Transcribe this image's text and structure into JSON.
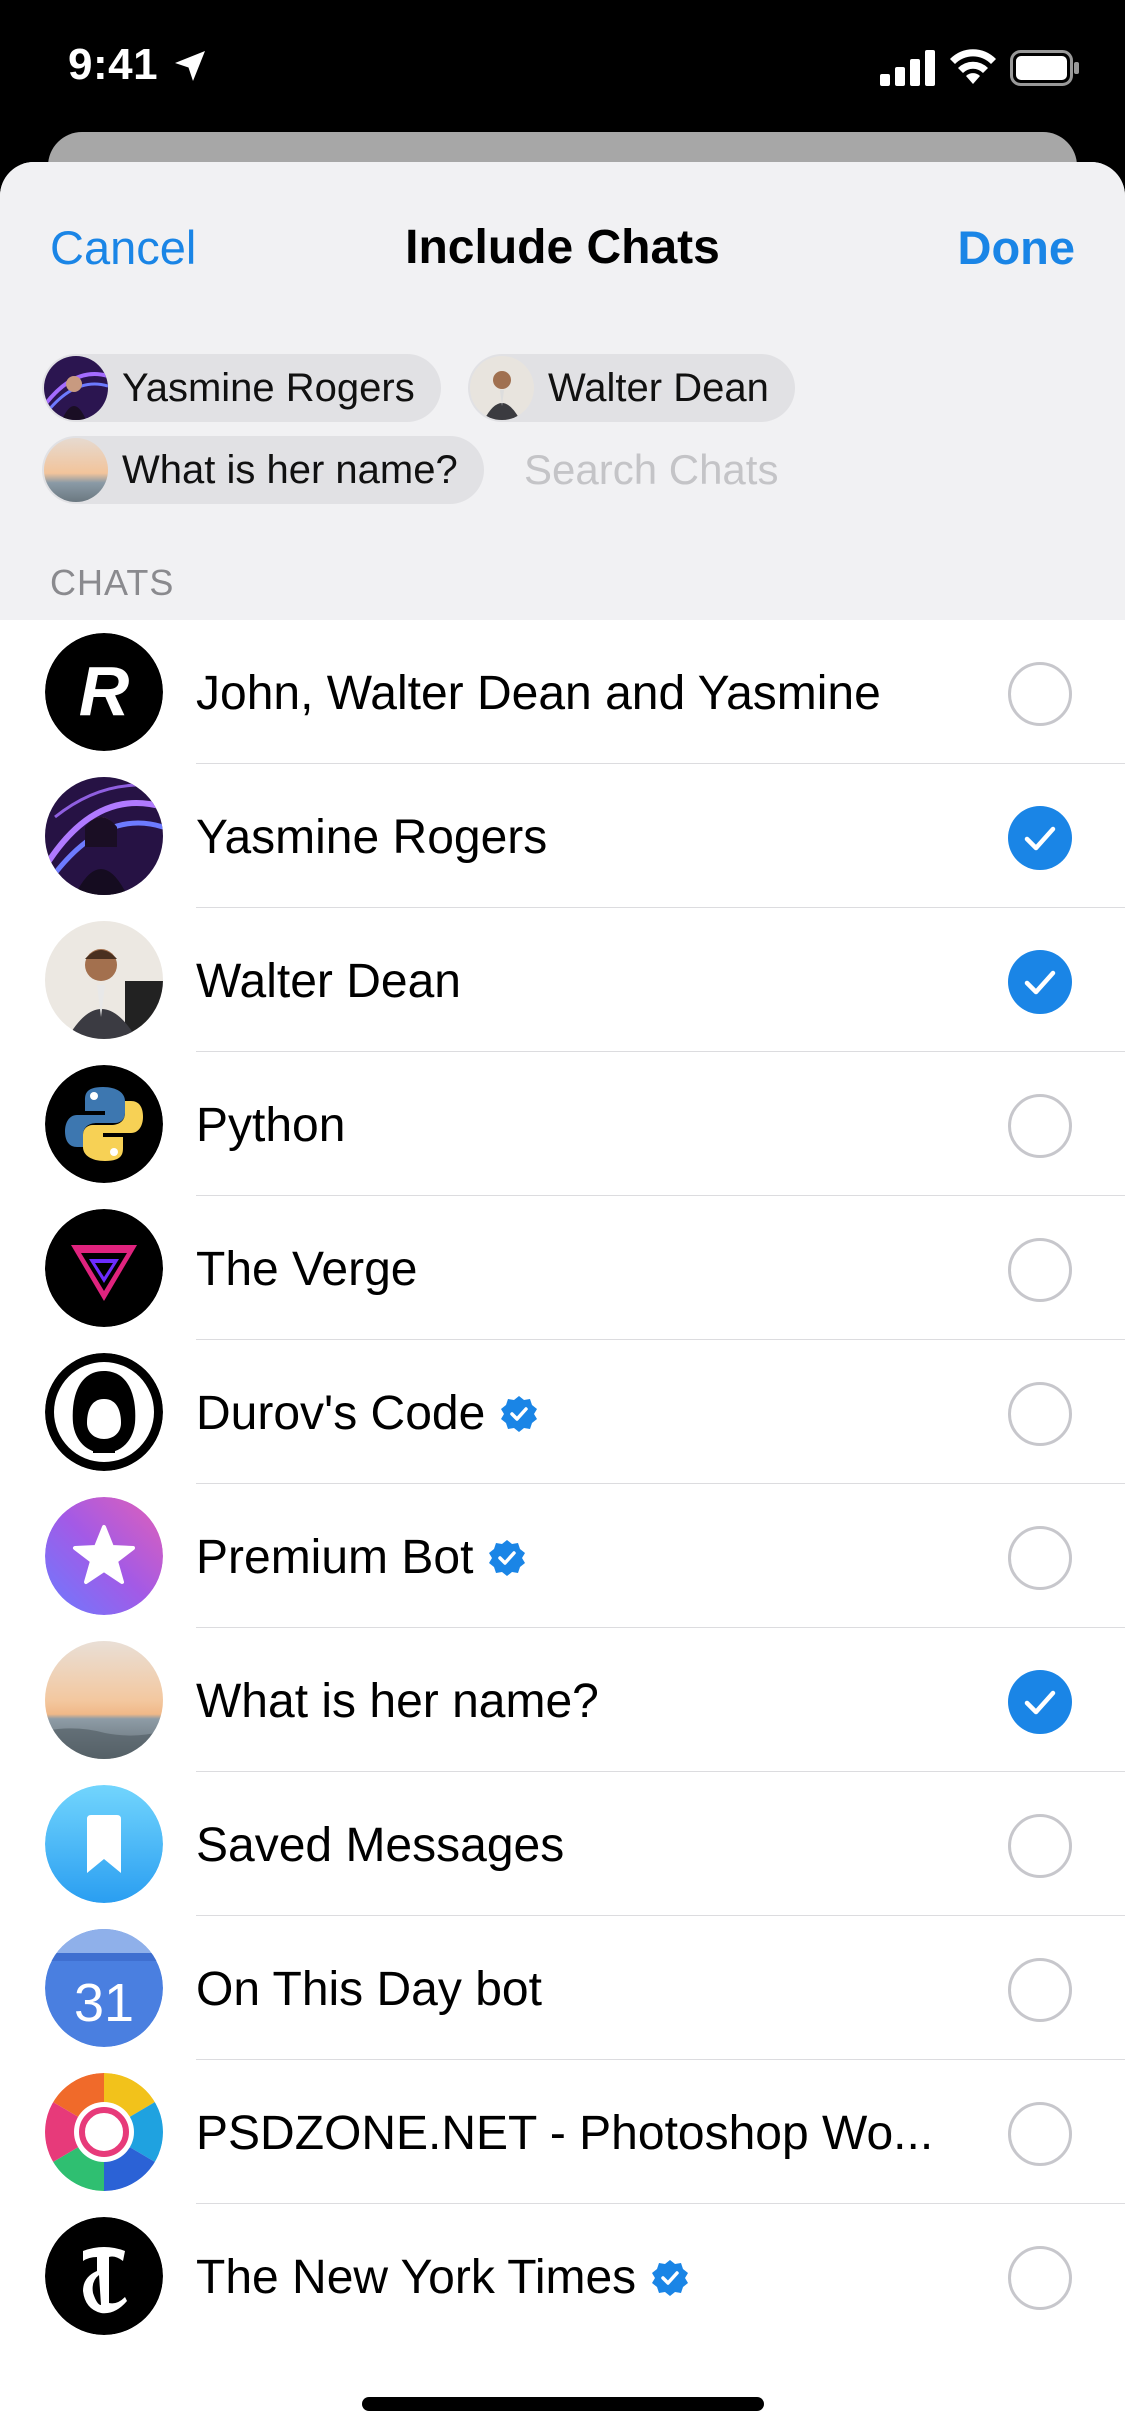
{
  "status": {
    "time": "9:41"
  },
  "nav": {
    "cancel": "Cancel",
    "title": "Include Chats",
    "done": "Done"
  },
  "tokens": [
    {
      "label": "Yasmine Rogers"
    },
    {
      "label": "Walter Dean"
    },
    {
      "label": "What is her name?"
    }
  ],
  "search": {
    "placeholder": "Search Chats"
  },
  "section": {
    "header": "CHATS"
  },
  "colors": {
    "accent": "#1a85e6",
    "separator": "#dcdcdf",
    "header_bg": "#f1f1f3"
  },
  "chats": [
    {
      "name": "John, Walter Dean and Yasmine",
      "avatar": "letter-r-avatar",
      "selected": false,
      "verified": false
    },
    {
      "name": "Yasmine Rogers",
      "avatar": "person-photo-avatar",
      "selected": true,
      "verified": false
    },
    {
      "name": "Walter Dean",
      "avatar": "person-photo-avatar",
      "selected": true,
      "verified": false
    },
    {
      "name": "Python",
      "avatar": "python-logo-avatar",
      "selected": false,
      "verified": false
    },
    {
      "name": "The Verge",
      "avatar": "verge-logo-avatar",
      "selected": false,
      "verified": false
    },
    {
      "name": "Durov's Code",
      "avatar": "hooded-figure-avatar",
      "selected": false,
      "verified": true
    },
    {
      "name": "Premium Bot",
      "avatar": "star-avatar",
      "selected": false,
      "verified": true
    },
    {
      "name": "What is her name?",
      "avatar": "sunset-photo-avatar",
      "selected": true,
      "verified": false
    },
    {
      "name": "Saved Messages",
      "avatar": "bookmark-avatar",
      "selected": false,
      "verified": false
    },
    {
      "name": "On This Day bot",
      "avatar": "calendar-avatar",
      "selected": false,
      "verified": false,
      "avatar_text": "31"
    },
    {
      "name": "PSDZONE.NET - Photoshop Wo...",
      "avatar": "color-wheel-avatar",
      "selected": false,
      "verified": false
    },
    {
      "name": "The New York Times",
      "avatar": "nyt-logo-avatar",
      "selected": false,
      "verified": true
    }
  ]
}
